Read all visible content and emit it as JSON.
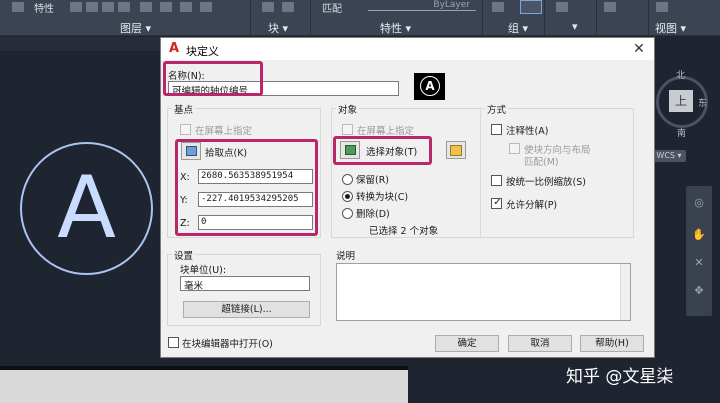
{
  "ribbon": {
    "frag_properties": "特性",
    "frag_match": "匹配",
    "bylayer": "ByLayer",
    "sections": {
      "layers": "图层 ▾",
      "block": "块 ▾",
      "properties": "特性 ▾",
      "groups": "组 ▾",
      "more": "▾",
      "view": "视图 ▾"
    }
  },
  "viewcube": {
    "north": "北",
    "east": "东",
    "south": "南",
    "face": "上",
    "wcs": "WCS ▾"
  },
  "canvas_block_letter": "A",
  "watermark": "知乎 @文星柒",
  "dialog": {
    "title": "块定义",
    "logo": "A",
    "close": "✕",
    "name_label": "名称(N):",
    "name_value": "可编辑的轴位编号",
    "combo_arrow": "⌄",
    "preview_letter": "A",
    "base_point": {
      "title": "基点",
      "specify_on_screen": "在屏幕上指定",
      "pick_point": "拾取点(K)",
      "x_label": "X:",
      "x_value": "2680.563538951954",
      "y_label": "Y:",
      "y_value": "-227.4019534295205",
      "z_label": "Z:",
      "z_value": "0"
    },
    "objects": {
      "title": "对象",
      "specify_on_screen": "在屏幕上指定",
      "select_objects": "选择对象(T)",
      "retain": "保留(R)",
      "convert_to_block": "转换为块(C)",
      "delete": "删除(D)",
      "selected_count": "已选择 2 个对象",
      "selected_option": "convert_to_block"
    },
    "behavior": {
      "title": "方式",
      "annotative": "注释性(A)",
      "match_orientation_line1": "使块方向与布局",
      "match_orientation_line2": "匹配(M)",
      "scale_uniformly": "按统一比例缩放(S)",
      "allow_exploding": "允许分解(P)",
      "allow_exploding_checked": true,
      "checkmark": "✓"
    },
    "settings": {
      "title": "设置",
      "block_unit_label": "块单位(U):",
      "block_unit_value": "毫米",
      "hyperlink": "超链接(L)..."
    },
    "description": {
      "title": "说明"
    },
    "open_in_editor": "在块编辑器中打开(O)",
    "ok": "确定",
    "cancel": "取消",
    "help": "帮助(H)"
  },
  "colors": {
    "highlight": "#b8266b",
    "canvas": "#1e2430",
    "ribbon": "#3b4453",
    "dialog": "#f0f0f0",
    "logo": "#d4261f"
  }
}
